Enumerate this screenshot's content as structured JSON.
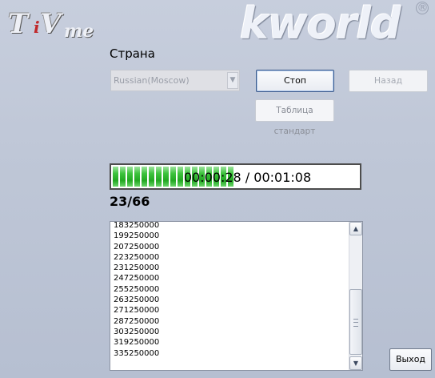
{
  "logos": {
    "left_brand": "TViMe",
    "right_brand": "kworld"
  },
  "country": {
    "label": "Страна",
    "selected": "Russian(Moscow)"
  },
  "buttons": {
    "stop": "Стоп",
    "back": "Назад",
    "table_standard": "Таблица стандарт",
    "exit": "Выход"
  },
  "progress": {
    "elapsed_total": "00:00:28 / 00:01:08",
    "fraction": 0.35,
    "segments": 17,
    "color": "#2cb82c"
  },
  "counter": "23/66",
  "frequencies": [
    "183250000",
    "199250000",
    "207250000",
    "223250000",
    "231250000",
    "247250000",
    "255250000",
    "263250000",
    "271250000",
    "287250000",
    "303250000",
    "319250000",
    "335250000"
  ],
  "icons": {
    "dropdown": "chevron-down-icon",
    "scroll_up": "arrow-up-icon",
    "scroll_down": "arrow-down-icon"
  }
}
